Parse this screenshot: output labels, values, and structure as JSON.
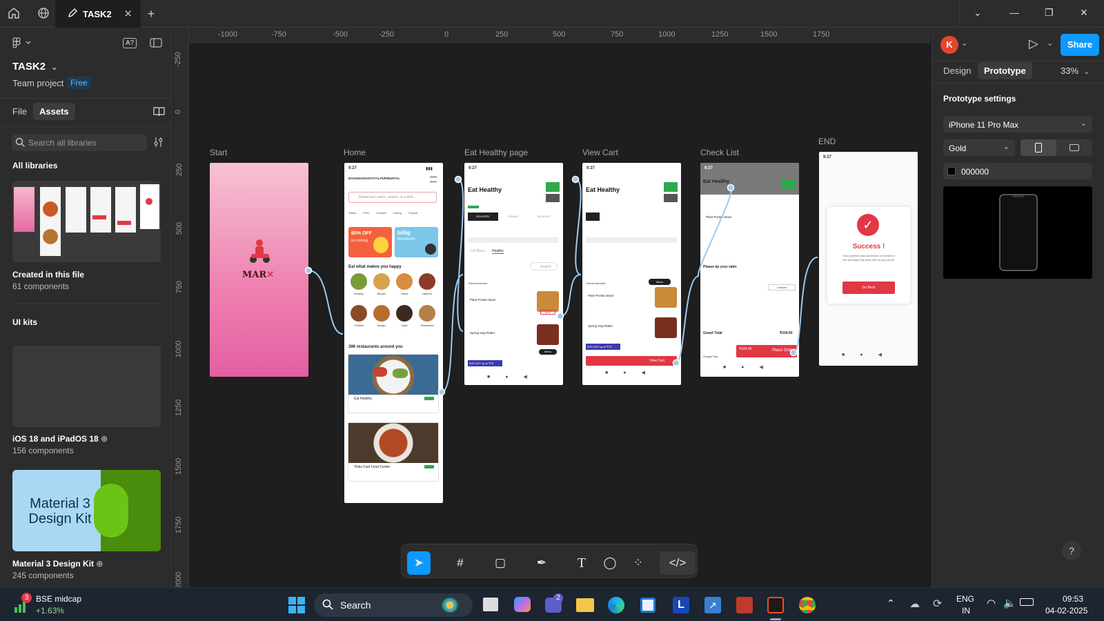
{
  "titlebar": {
    "tab_title": "TASK2",
    "close": "✕",
    "new_tab": "+"
  },
  "left_panel": {
    "file_name": "TASK2",
    "project": "Team project",
    "plan_badge": "Free",
    "tabs": [
      "File",
      "Assets"
    ],
    "search_placeholder": "Search all libraries",
    "all_libraries": "All libraries",
    "libraries": [
      {
        "name": "Created in this file",
        "count": "61 components"
      },
      {
        "name": "iOS 18 and iPadOS 18",
        "count": "156 components"
      },
      {
        "name": "Material 3 Design Kit",
        "count": "245 components"
      }
    ],
    "ui_kits": "UI kits",
    "material_thumb_text": "Material 3 Design Kit"
  },
  "rulers": {
    "top": [
      "-1000",
      "-750",
      "-500",
      "-250",
      "0",
      "250",
      "500",
      "750",
      "1000",
      "1250",
      "1500",
      "1750"
    ],
    "left": [
      "-250",
      "0",
      "250",
      "500",
      "750",
      "1000",
      "1250",
      "1500",
      "1750",
      "2000"
    ]
  },
  "frames": {
    "start": {
      "label": "Start",
      "logo": "MAR"
    },
    "home": {
      "label": "Home",
      "time": "9:27",
      "address": "BANGMARIANTOTALPURIBUNTAL",
      "search": "Restaurant name, cuisine, or a dish...",
      "promo1": "60% OFF",
      "promo1_sub": "no cooking",
      "promo2": "billig",
      "promo2_sub": "discounts",
      "section1": "Eat what makes you happy",
      "foods": [
        "Healthy",
        "Biryani",
        "Pizza",
        "Haleem",
        "Chicken",
        "Burger",
        "Cake",
        "Shawarma"
      ],
      "section2": "396 restaurants around you",
      "rest1": "Eat Healthy",
      "rest2": "Tinku Fast Food Center"
    },
    "eat_healthy": {
      "label": "Eat Healthy  page",
      "time": "9:27",
      "title": "Eat Healthy",
      "tabs": [
        "DELIVERY",
        "DINING",
        "REVIEWS"
      ],
      "menu_tabs": [
        "Full Menu",
        "Healthy"
      ],
      "search": "Search",
      "rec": "Recommended",
      "item1": "Plant Protein Bowl",
      "item2": "Spring Veg Platter",
      "offer": "30% OFF up to ₹75",
      "menu_btn": "Menu",
      "add": "ADD"
    },
    "view_cart": {
      "label": "View Cart",
      "time": "9:27",
      "title": "Eat Healthy",
      "rec": "Recommended",
      "item1": "Plant Protein Bowl",
      "item2": "Spring Veg Platter",
      "offer": "30% OFF up to ₹75",
      "cart_btn": "View Cart",
      "menu_btn": "Menu"
    },
    "check_list": {
      "label": "Check List",
      "time": "9:27",
      "title": "Eat Healthy",
      "item": "Plant Protein Bowl",
      "tip": "Please tip your valet",
      "grand": "Grand Total",
      "grand_val": "₹334.00",
      "pay": "Google Pay",
      "price": "₹334.00",
      "place": "Place Order"
    },
    "end": {
      "label": "END",
      "time": "9:27",
      "title": "Success !",
      "msg": "Your payment was successful. A receipt for this purchase has been sent to your email.",
      "btn": "Go Back"
    }
  },
  "toolbar": {
    "tools": [
      "move",
      "frame",
      "shape",
      "pen",
      "text",
      "comment",
      "components",
      "dev-mode"
    ]
  },
  "right_panel": {
    "avatar": "K",
    "share": "Share",
    "tabs": [
      "Design",
      "Prototype"
    ],
    "zoom": "33%",
    "settings_title": "Prototype settings",
    "device": "iPhone 11 Pro Max",
    "color_model": "Gold",
    "bg_hex": "000000",
    "help": "?"
  },
  "taskbar": {
    "stock_name": "BSE midcap",
    "stock_change": "+1.63%",
    "stock_badge": "3",
    "search": "Search",
    "teams_badge": "2",
    "lang1": "ENG",
    "lang2": "IN",
    "time": "09:53",
    "date": "04-02-2025"
  },
  "colors": {
    "accent": "#0d99ff",
    "food_red": "#e23744",
    "green": "#2fa84f",
    "canvas": "#1e1e1e",
    "panel": "#2c2c2c"
  }
}
